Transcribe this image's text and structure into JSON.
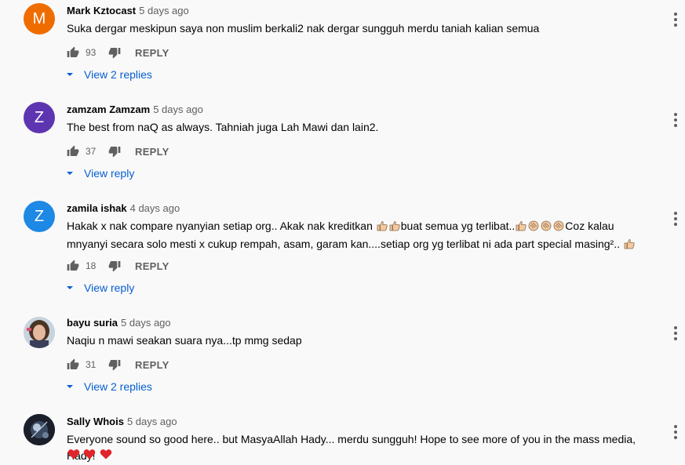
{
  "comments": [
    {
      "author": "Mark Kztocast",
      "time": "5 days ago",
      "avatar_letter": "M",
      "avatar_color": "#ef6c00",
      "text": "Suka dergar meskipun saya non muslim berkali2 nak dergar sungguh merdu taniah kalian semua",
      "likes": "93",
      "reply_label": "REPLY",
      "view_replies": "View 2 replies"
    },
    {
      "author": "zamzam Zamzam",
      "time": "5 days ago",
      "avatar_letter": "Z",
      "avatar_color": "#5e35b1",
      "text": "The best from naQ as always. Tahniah juga Lah Mawi dan lain2.",
      "likes": "37",
      "reply_label": "REPLY",
      "view_replies": "View reply"
    },
    {
      "author": "zamila ishak",
      "time": "4 days ago",
      "avatar_letter": "Z",
      "avatar_color": "#1e88e5",
      "text_parts": [
        "Hakak x nak compare nyanyian setiap org.. Akak nak kreditkan ",
        "buat semua yg terlibat..",
        "Coz kalau mnyanyi secara solo mesti x cukup rempah, asam, garam kan....setiap org yg terlibat ni ada part special masing².. "
      ],
      "likes": "18",
      "reply_label": "REPLY",
      "view_replies": "View reply"
    },
    {
      "author": "bayu suria",
      "time": "5 days ago",
      "text": "Naqiu n mawi seakan suara nya...tp mmg sedap",
      "likes": "31",
      "reply_label": "REPLY",
      "view_replies": "View 2 replies"
    },
    {
      "author": "Sally Whois",
      "time": "5 days ago",
      "text": "Everyone sound so good here.. but MasyaAllah Hady... merdu sungguh! Hope to see more of you in the mass media, Hady!"
    }
  ],
  "colors": {
    "link_blue": "#065fd4",
    "muted": "#606060",
    "heart_red": "#e0242a"
  }
}
